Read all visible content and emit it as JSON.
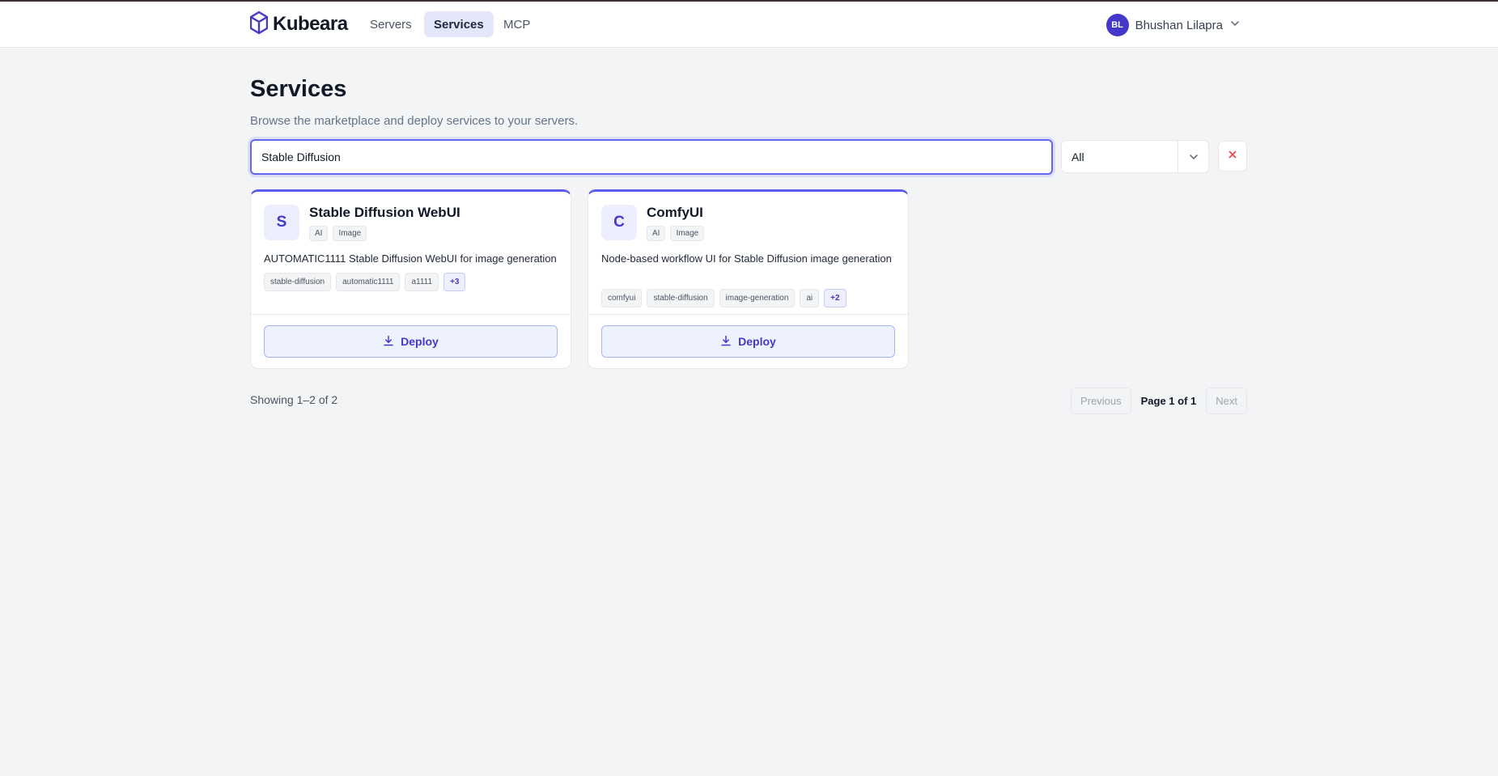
{
  "app": {
    "name": "Kubeara"
  },
  "nav": {
    "links": [
      {
        "label": "Servers",
        "active": false
      },
      {
        "label": "Services",
        "active": true
      },
      {
        "label": "MCP",
        "active": false
      }
    ]
  },
  "user": {
    "initials": "BL",
    "name": "Bhushan Lilapra"
  },
  "page": {
    "title": "Services",
    "subtitle": "Browse the marketplace and deploy services to your servers."
  },
  "search": {
    "value": "Stable Diffusion",
    "placeholder": ""
  },
  "filter": {
    "selected": "All"
  },
  "cards": [
    {
      "initial": "S",
      "name": "Stable Diffusion WebUI",
      "categories": [
        "AI",
        "Image"
      ],
      "description": "AUTOMATIC1111 Stable Diffusion WebUI for image generation",
      "tags": [
        "stable-diffusion",
        "automatic1111",
        "a1111"
      ],
      "more": "+3",
      "deploy_label": "Deploy"
    },
    {
      "initial": "C",
      "name": "ComfyUI",
      "categories": [
        "AI",
        "Image"
      ],
      "description": "Node-based workflow UI for Stable Diffusion image generation",
      "tags": [
        "comfyui",
        "stable-diffusion",
        "image-generation",
        "ai"
      ],
      "more": "+2",
      "deploy_label": "Deploy"
    }
  ],
  "pagination": {
    "showing": "Showing 1–2 of 2",
    "previous_label": "Previous",
    "page_info": "Page 1 of 1",
    "next_label": "Next"
  },
  "colors": {
    "accent": "#4338ca",
    "card_top_border": "#5b5bf0",
    "clear_icon": "#ef4444"
  },
  "icons": [
    "kubeara-logo-icon",
    "chevron-down-icon",
    "close-icon",
    "download-icon"
  ]
}
